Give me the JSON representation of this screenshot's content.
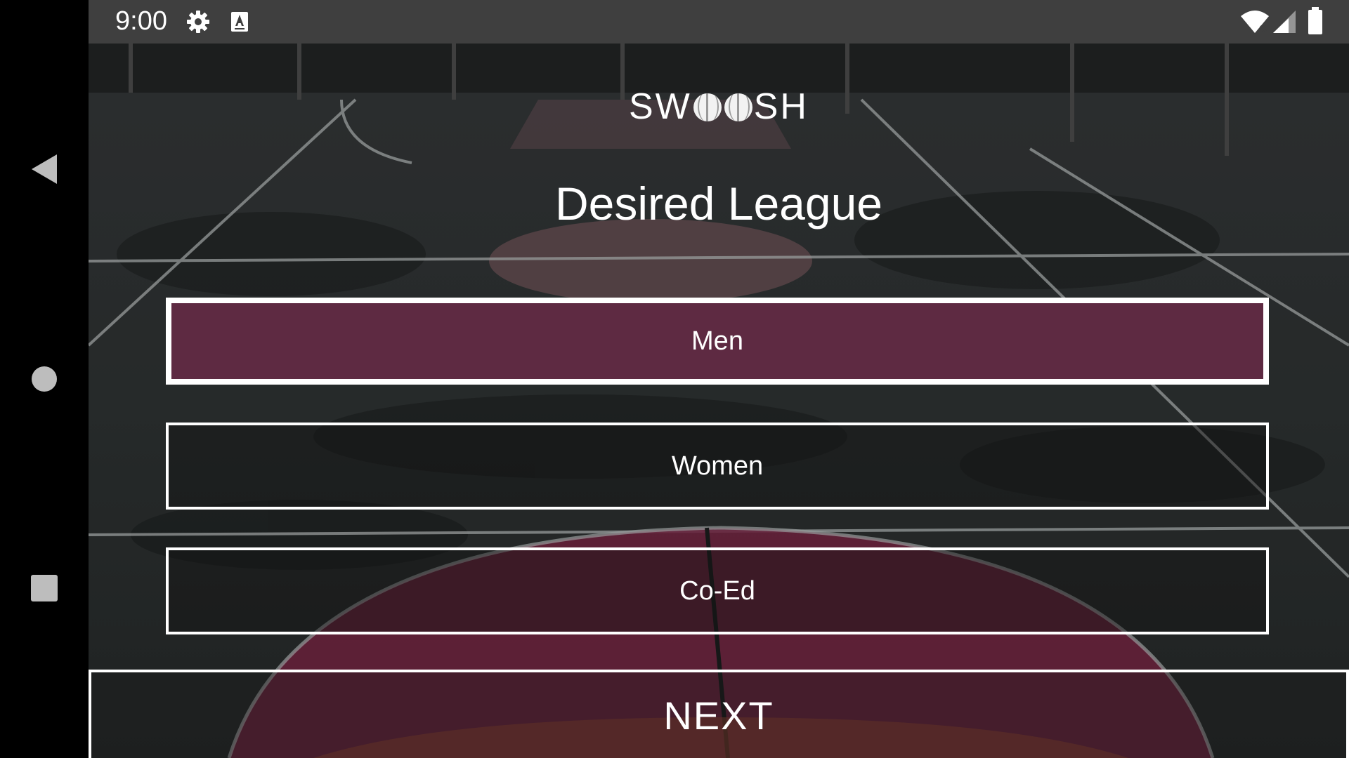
{
  "status_bar": {
    "time": "9:00",
    "icons": [
      "gear-icon",
      "keyboard-a-icon",
      "wifi-icon",
      "signal-icon",
      "battery-icon"
    ]
  },
  "nav_bar": {
    "icons": [
      "back-triangle-icon",
      "home-circle-icon",
      "recents-square-icon"
    ]
  },
  "app": {
    "logo": {
      "prefix": "SW",
      "suffix": "SH"
    },
    "title": "Desired League",
    "options": [
      {
        "label": "Men",
        "selected": true
      },
      {
        "label": "Women",
        "selected": false
      },
      {
        "label": "Co-Ed",
        "selected": false
      }
    ],
    "next_label": "NEXT"
  },
  "colors": {
    "selected_fill": "#5e2a42",
    "status_bar_bg": "#3f3f3f",
    "border": "#ffffff",
    "court_paint": "#8a2a4e"
  }
}
